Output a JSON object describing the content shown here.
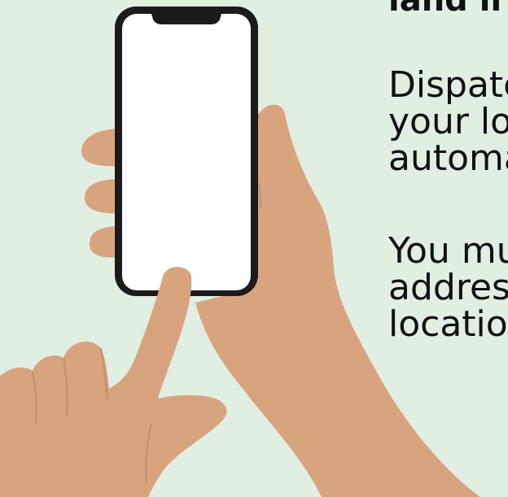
{
  "heading": "land li",
  "paragraph_1": {
    "lines": [
      "Dispatc",
      "your lo",
      "automa"
    ]
  },
  "paragraph_2": {
    "lines": [
      "You mu",
      "addres",
      "locatio"
    ]
  },
  "colors": {
    "background": "#e0efe2",
    "skin": "#d8a47e",
    "skin_shadow": "#c08f6c",
    "phone_frame": "#1b1b1b",
    "phone_screen": "#ffffff",
    "text": "#111111"
  },
  "illustration": {
    "subject": "hands-holding-smartphone"
  }
}
